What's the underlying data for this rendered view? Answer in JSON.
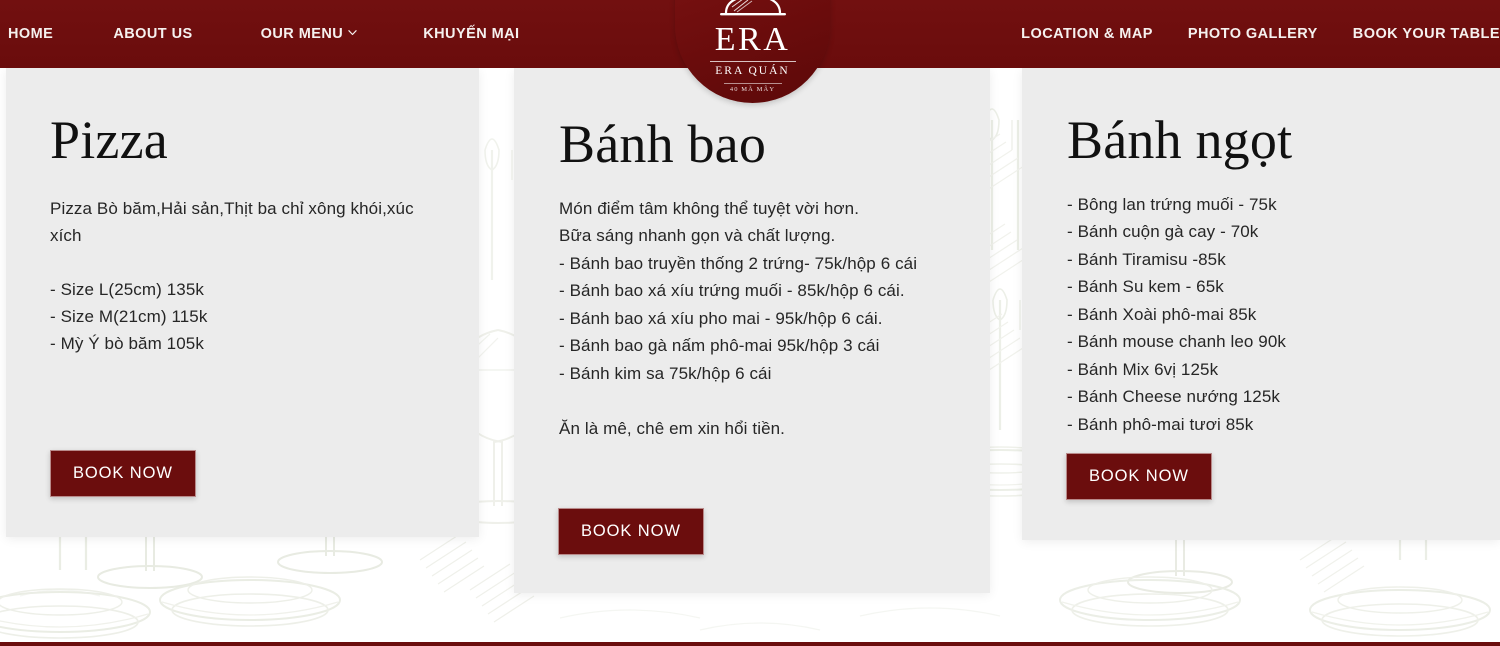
{
  "site": {
    "brand": {
      "logo_main": "ERA",
      "logo_sub": "ERA QUÁN",
      "logo_address": "40 MÃ MÂY",
      "logo_icon": "cloche-icon"
    },
    "colors": {
      "brand_maroon": "#6b0d0d",
      "header_maroon": "#6e0e0e",
      "card_bg": "#ececec",
      "page_bg": "#ffffff",
      "text_dark": "#262626",
      "watermark_green": "#cfd4c2"
    }
  },
  "header": {
    "nav_left": [
      {
        "label": "HOME",
        "name": "nav-home",
        "has_chevron": false
      },
      {
        "label": "ABOUT US",
        "name": "nav-about-us",
        "has_chevron": false
      },
      {
        "label": "OUR MENU",
        "name": "nav-our-menu",
        "has_chevron": true
      },
      {
        "label": "KHUYẾN MẠI",
        "name": "nav-khuyen-mai",
        "has_chevron": false
      }
    ],
    "nav_right": [
      {
        "label": "LOCATION & MAP",
        "name": "nav-location-map",
        "has_chevron": false
      },
      {
        "label": "PHOTO GALLERY",
        "name": "nav-photo-gallery",
        "has_chevron": false
      },
      {
        "label": "BOOK YOUR TABLE",
        "name": "nav-book-your-table",
        "has_chevron": false
      }
    ]
  },
  "cards": [
    {
      "title": "Pizza",
      "body": "Pizza Bò băm,Hải sản,Thịt ba chỉ xông khói,xúc xích\n\n- Size L(25cm) 135k\n- Size M(21cm) 115k\n- Mỳ Ý bò băm 105k",
      "button_label": "BOOK NOW"
    },
    {
      "title": "Bánh bao",
      "body": "Món điểm tâm không thể tuyệt vời hơn.\nBữa sáng nhanh gọn và chất lượng.\n- Bánh bao truyền thống 2 trứng- 75k/hộp 6 cái\n- Bánh bao xá xíu trứng muối - 85k/hộp 6 cái.\n- Bánh bao xá xíu pho mai - 95k/hộp 6 cái.\n- Bánh bao gà nấm phô-mai 95k/hộp 3 cái\n- Bánh kim sa 75k/hộp 6 cái\n\nĂn là mê, chê em xin hổi tiền.",
      "button_label": "BOOK NOW"
    },
    {
      "title": "Bánh ngọt",
      "body": "- Bông lan trứng muối - 75k\n- Bánh cuộn gà cay - 70k\n- Bánh Tiramisu -85k\n- Bánh Su kem - 65k\n- Bánh Xoài phô-mai 85k\n- Bánh mouse chanh leo 90k\n- Bánh Mix 6vị 125k\n- Bánh Cheese nướng 125k\n- Bánh phô-mai tươi 85k",
      "button_label": "BOOK NOW"
    }
  ]
}
